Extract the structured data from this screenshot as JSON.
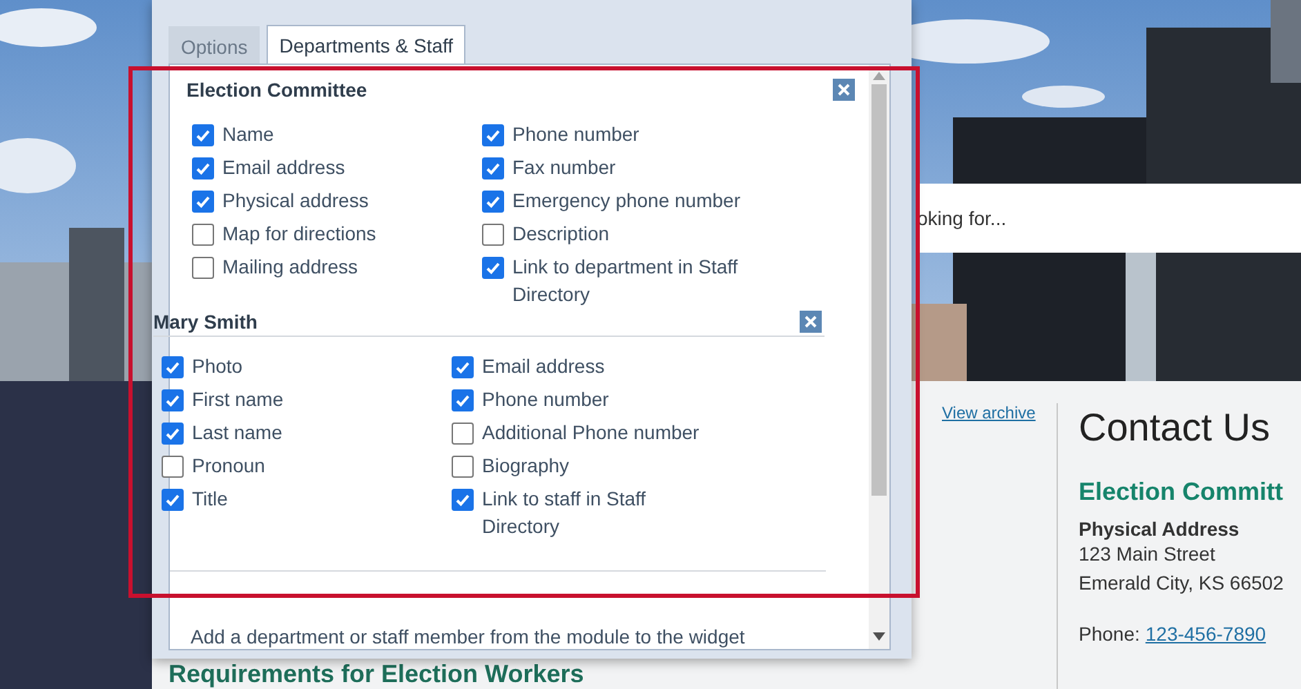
{
  "page": {
    "search": {
      "placeholder": "oking for..."
    },
    "archive_link": "View archive",
    "contact": {
      "title": "Contact Us",
      "department": "Election Committ",
      "address_label": "Physical Address",
      "address_lines": [
        "123 Main Street",
        "Emerald City, KS 66502"
      ],
      "phone_label": "Phone:",
      "phone": "123-456-7890"
    },
    "heading": "Requirements for Election Workers"
  },
  "dialog": {
    "tabs": [
      {
        "label": "Options",
        "selected": false
      },
      {
        "label": "Departments & Staff",
        "selected": true
      }
    ],
    "sections": [
      {
        "title": "Election Committee",
        "columns": [
          [
            {
              "label": "Name",
              "checked": true
            },
            {
              "label": "Email address",
              "checked": true
            },
            {
              "label": "Physical address",
              "checked": true
            },
            {
              "label": "Map for directions",
              "checked": false
            },
            {
              "label": "Mailing address",
              "checked": false
            }
          ],
          [
            {
              "label": "Phone number",
              "checked": true
            },
            {
              "label": "Fax number",
              "checked": true
            },
            {
              "label": "Emergency phone number",
              "checked": true
            },
            {
              "label": "Description",
              "checked": false
            },
            {
              "label": "Link to department in Staff Directory",
              "checked": true
            }
          ]
        ]
      },
      {
        "title": "Mary Smith",
        "columns": [
          [
            {
              "label": "Photo",
              "checked": true
            },
            {
              "label": "First name",
              "checked": true
            },
            {
              "label": "Last name",
              "checked": true
            },
            {
              "label": "Pronoun",
              "checked": false
            },
            {
              "label": "Title",
              "checked": true
            }
          ],
          [
            {
              "label": "Email address",
              "checked": true
            },
            {
              "label": "Phone number",
              "checked": true
            },
            {
              "label": "Additional Phone number",
              "checked": false
            },
            {
              "label": "Biography",
              "checked": false
            },
            {
              "label": "Link to staff in Staff Directory",
              "checked": true
            }
          ]
        ]
      }
    ],
    "hint": "Add a department or staff member from the module to the widget"
  }
}
